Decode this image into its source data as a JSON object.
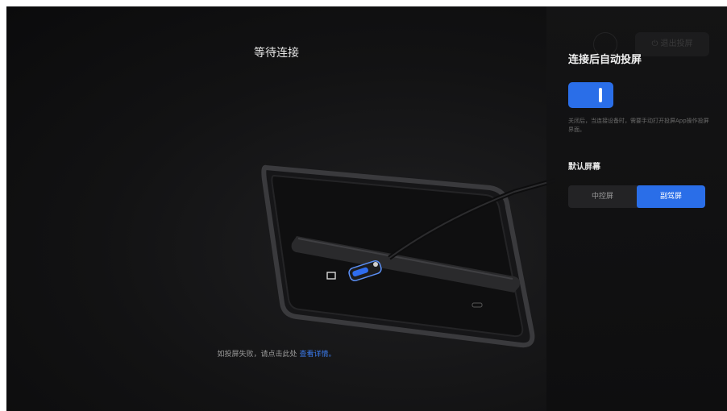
{
  "main": {
    "title": "等待连接",
    "hint_text": "如投屏失败，请点击此处",
    "hint_link": "查看详情。"
  },
  "panel": {
    "title": "连接后自动投屏",
    "toggle_on": true,
    "description": "关闭后，当连接设备时，需要手动打开投屏App操作投屏界面。",
    "default_screen_label": "默认屏幕",
    "screen_options": [
      "中控屏",
      "副驾屏"
    ],
    "screen_selected": "副驾屏",
    "exit_button_label": "退出投屏"
  },
  "colors": {
    "accent": "#2a6ee8",
    "link": "#3b7cf0",
    "background": "#121213"
  },
  "icons": {
    "cable": "usb-c-cable-icon",
    "port": "usb-port-icon",
    "screen": "screen-port-icon"
  }
}
